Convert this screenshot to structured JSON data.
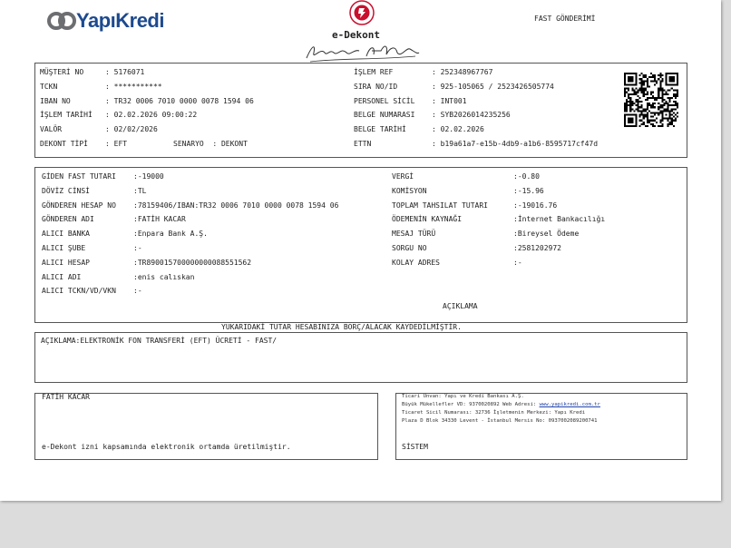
{
  "header": {
    "brand": "YapıKredi",
    "doc_title": "e-Dekont",
    "type_label": "FAST GÖNDERİMİ"
  },
  "info_left": [
    {
      "label": "MÜŞTERİ NO",
      "value": "5176071"
    },
    {
      "label": "TCKN",
      "value": "***********"
    },
    {
      "label": "IBAN NO",
      "value": "TR32 0006 7010 0000 0078 1594 06"
    },
    {
      "label": "İŞLEM TARİHİ",
      "value": "02.02.2026 09:00:22"
    },
    {
      "label": "VALÖR",
      "value": "02/02/2026"
    },
    {
      "label": "DEKONT TİPİ",
      "value": "EFT"
    }
  ],
  "senaryo": {
    "label": "SENARYO",
    "value": "DEKONT"
  },
  "info_right": [
    {
      "label": "İŞLEM REF",
      "value": "252348967767"
    },
    {
      "label": "SIRA NO/ID",
      "value": "925-105065 / 2523426505774"
    },
    {
      "label": "PERSONEL SİCİL",
      "value": "INT001"
    },
    {
      "label": "BELGE NUMARASI",
      "value": "SYB2026014235256"
    },
    {
      "label": "BELGE TARİHİ",
      "value": "02.02.2026"
    },
    {
      "label": "ETTN",
      "value": "b19a61a7-e15b-4db9-a1b6-8595717cf47d"
    }
  ],
  "tx_left": [
    {
      "label": "GİDEN FAST TUTARI",
      "value": "-19000"
    },
    {
      "label": "DÖVİZ CİNSİ",
      "value": "TL"
    },
    {
      "label": "GÖNDEREN HESAP NO",
      "value": "78159406/IBAN:TR32 0006 7010 0000 0078 1594 06"
    },
    {
      "label": "GÖNDEREN ADI",
      "value": "FATİH KACAR"
    },
    {
      "label": "ALICI BANKA",
      "value": "Enpara Bank A.Ş."
    },
    {
      "label": "ALICI ŞUBE",
      "value": "-"
    },
    {
      "label": "ALICI HESAP",
      "value": "TR890015700000000088551562"
    },
    {
      "label": "ALICI ADI",
      "value": "enis calıskan"
    },
    {
      "label": "ALICI TCKN/VD/VKN",
      "value": "-"
    }
  ],
  "tx_right": [
    {
      "label": "VERGİ",
      "value": "-0.80"
    },
    {
      "label": "KOMİSYON",
      "value": "-15.96"
    },
    {
      "label": "TOPLAM TAHSILAT TUTARI",
      "value": "-19016.76"
    },
    {
      "label": "ÖDEMENİN KAYNAĞI",
      "value": "İnternet Bankacılığı"
    },
    {
      "label": "MESAJ TÜRÜ",
      "value": "Bireysel Ödeme"
    },
    {
      "label": "SORGU NO",
      "value": "2581202972"
    },
    {
      "label": "KOLAY ADRES",
      "value": "-"
    }
  ],
  "aciklama_heading": "AÇIKLAMA",
  "notice": "YUKARIDAKİ TUTAR HESABINIZA BORÇ/ALACAK KAYDEDİLMİŞTİR.",
  "description": "AÇIKLAMA:ELEKTRONİK FON TRANSFERİ (EFT) ÜCRETİ - FAST/",
  "customer_name": "FATİH KACAR",
  "electronic_note": "e-Dekont izni kapsamında elektronik ortamda üretilmiştir.",
  "company": {
    "line1": "Ticari Unvan: Yapı ve Kredi Bankası A.Ş.",
    "line2_prefix": "Büyük Mükellefler VD: 9370020892 Web Adresi: ",
    "website": "www.yapikredi.com.tr",
    "line3": "Ticaret Sicil Numarası: 32736 İşletmenin Merkezi: Yapı Kredi",
    "line4": "Plaza D Blok 34330 Levent - İstanbul Mersis No: 0937002089200741"
  },
  "system_label": "SİSTEM",
  "colors": {
    "brand": "#1d4a8f",
    "stamp": "#c8102e",
    "border": "#555555"
  }
}
